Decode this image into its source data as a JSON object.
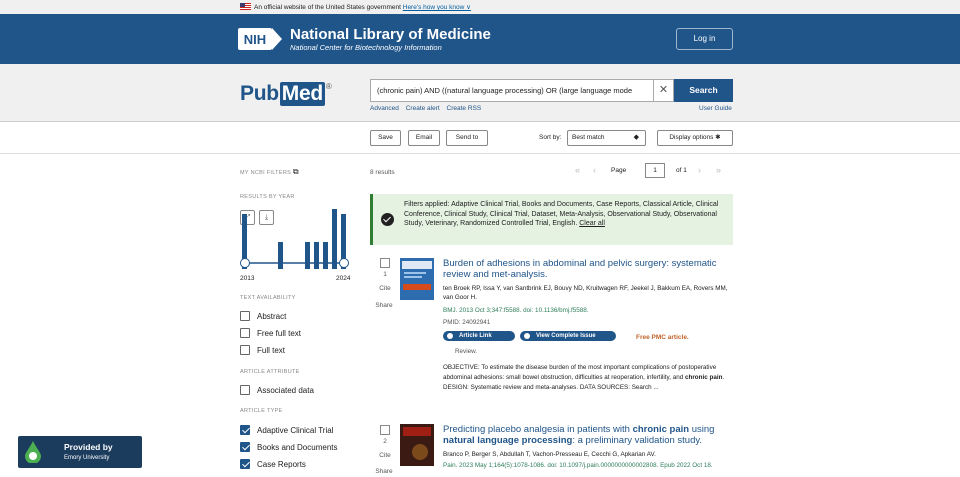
{
  "gov_banner": {
    "text": "An official website of the United States government",
    "link": "Here's how you know ∨"
  },
  "header": {
    "title": "National Library of Medicine",
    "subtitle": "National Center for Biotechnology Information",
    "login": "Log in",
    "logo_text": "NIH"
  },
  "search": {
    "logo": {
      "pub": "Pub",
      "med": "Med"
    },
    "query": "(chronic pain) AND ((natural language processing) OR (large language mode",
    "button": "Search",
    "links": [
      "Advanced",
      "Create alert",
      "Create RSS"
    ],
    "user_guide": "User Guide"
  },
  "toolbar": {
    "save": "Save",
    "email": "Email",
    "send_to": "Send to",
    "sort_label": "Sort by:",
    "sort_value": "Best match",
    "display": "Display options"
  },
  "sidebar": {
    "my_filters": "MY NCBI FILTERS",
    "results_by_year": "RESULTS BY YEAR",
    "year_start": "2013",
    "year_end": "2024",
    "text_availability": "TEXT AVAILABILITY",
    "text_options": [
      {
        "label": "Abstract",
        "checked": false
      },
      {
        "label": "Free full text",
        "checked": false
      },
      {
        "label": "Full text",
        "checked": false
      }
    ],
    "article_attribute": "ARTICLE ATTRIBUTE",
    "attr_options": [
      {
        "label": "Associated data",
        "checked": false
      }
    ],
    "article_type": "ARTICLE TYPE",
    "type_options": [
      {
        "label": "Adaptive Clinical Trial",
        "checked": true
      },
      {
        "label": "Books and Documents",
        "checked": true
      },
      {
        "label": "Case Reports",
        "checked": true
      }
    ]
  },
  "chart_data": {
    "type": "bar",
    "categories": [
      "2013",
      "2014",
      "2015",
      "2016",
      "2017",
      "2018",
      "2019",
      "2020",
      "2021",
      "2022",
      "2023",
      "2024"
    ],
    "values": [
      1,
      0,
      0,
      0,
      0.5,
      0,
      0,
      0.5,
      0.5,
      0.5,
      1.1,
      1
    ],
    "note_scale": "relative"
  },
  "results": {
    "count": "8 results",
    "page_label": "Page",
    "page": "1",
    "of": "of 1",
    "filters_text": "Filters applied: Adaptive Clinical Trial, Books and Documents, Case Reports, Classical Article, Clinical Conference, Clinical Study, Clinical Trial, Dataset, Meta-Analysis, Observational Study, Observational Study, Veterinary, Randomized Controlled Trial, English.",
    "clear_all": "Clear all",
    "items": [
      {
        "num": "1",
        "cite": "Cite",
        "share": "Share",
        "title": "Burden of adhesions in abdominal and pelvic surgery: systematic review and met-analysis.",
        "authors": "ten Broek RP, Issa Y, van Santbrink EJ, Bouvy ND, Kruitwagen RF, Jeekel J, Bakkum EA, Rovers MM, van Goor H.",
        "citation": "BMJ. 2013 Oct 3;347:f5588. doi: 10.1136/bmj.f5588.",
        "pmid": "PMID: 24092941",
        "pill1": "Article Link",
        "pill2": "View Complete Issue",
        "free": "Free PMC article.",
        "review": "Review.",
        "snippet_a": "OBJECTIVE: To estimate the disease burden of the most important complications of postoperative abdominal adhesions: small bowel obstruction, difficulties at reoperation, infertility, and",
        "snippet_bold": "chronic pain",
        "snippet_b": ". DESIGN: Systematic review and meta-analyses. DATA SOURCES: Search ..."
      },
      {
        "num": "2",
        "cite": "Cite",
        "share": "Share",
        "title_a": "Predicting placebo analgesia in patients with ",
        "title_b1": "chronic pain",
        "title_c": " using ",
        "title_b2": "natural language processing",
        "title_d": ": a preliminary validation study.",
        "authors": "Branco P, Berger S, Abdullah T, Vachon-Presseau E, Cecchi G, Apkarian AV.",
        "citation": "Pain. 2023 May 1;164(5):1078-1086. doi: 10.1097/j.pain.0000000000002808. Epub 2022 Oct 18."
      }
    ]
  },
  "provided_by": {
    "line1": "Provided by",
    "line2": "Emory University"
  },
  "colors": {
    "brand": "#20558a",
    "filter_bg": "#e5f2e2",
    "free": "#c1622a"
  }
}
